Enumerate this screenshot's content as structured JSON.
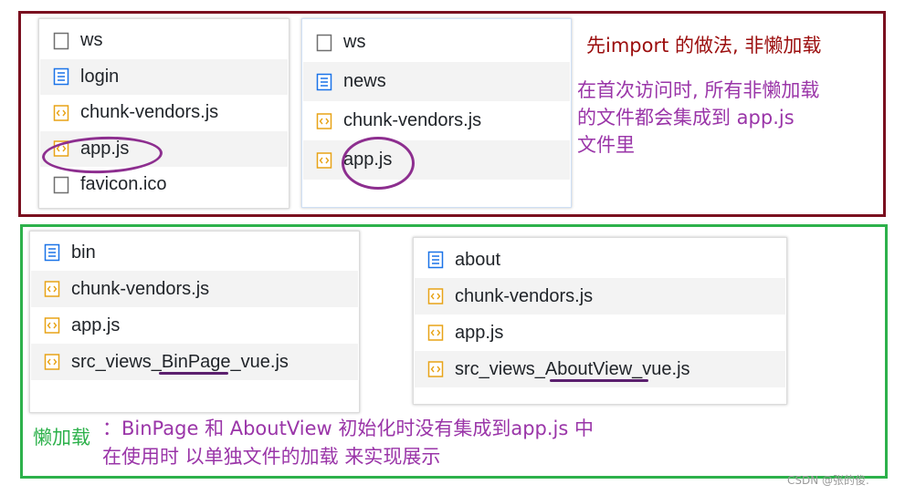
{
  "colors": {
    "top_frame": "#7a0f1f",
    "bottom_frame": "#2db14b",
    "annotation_red": "#9b0d0d",
    "annotation_purple": "#9a35a8",
    "annotation_green": "#2db14b",
    "highlight_ring": "#8d2e8f",
    "underline": "#5b1f6e",
    "row_alt": "#f3f3f3"
  },
  "panels": {
    "top_left": [
      {
        "name": "ws",
        "icon": "blank-file-icon"
      },
      {
        "name": "login",
        "icon": "document-icon"
      },
      {
        "name": "chunk-vendors.js",
        "icon": "js-file-icon"
      },
      {
        "name": "app.js",
        "icon": "js-file-icon"
      },
      {
        "name": "favicon.ico",
        "icon": "blank-file-icon"
      }
    ],
    "top_right": [
      {
        "name": "ws",
        "icon": "blank-file-icon"
      },
      {
        "name": "news",
        "icon": "document-icon"
      },
      {
        "name": "chunk-vendors.js",
        "icon": "js-file-icon"
      },
      {
        "name": "app.js",
        "icon": "js-file-icon"
      }
    ],
    "bottom_left": [
      {
        "name": "bin",
        "icon": "document-icon"
      },
      {
        "name": "chunk-vendors.js",
        "icon": "js-file-icon"
      },
      {
        "name": "app.js",
        "icon": "js-file-icon"
      },
      {
        "name": "src_views_BinPage_vue.js",
        "icon": "js-file-icon"
      }
    ],
    "bottom_right": [
      {
        "name": "about",
        "icon": "document-icon"
      },
      {
        "name": "chunk-vendors.js",
        "icon": "js-file-icon"
      },
      {
        "name": "app.js",
        "icon": "js-file-icon"
      },
      {
        "name": "src_views_AboutView_vue.js",
        "icon": "js-file-icon"
      }
    ]
  },
  "annotations": {
    "top_title": "先import 的做法, 非懒加载",
    "top_desc": "在首次访问时, 所有非懒加载\n的文件都会集成到 app.js\n文件里",
    "lazy_label": "懒加载",
    "lazy_desc": "：BinPage 和 AboutView 初始化时没有集成到app.js 中\n在使用时 以单独文件的加载 来实现展示"
  },
  "watermark": "CSDN @张的俊."
}
